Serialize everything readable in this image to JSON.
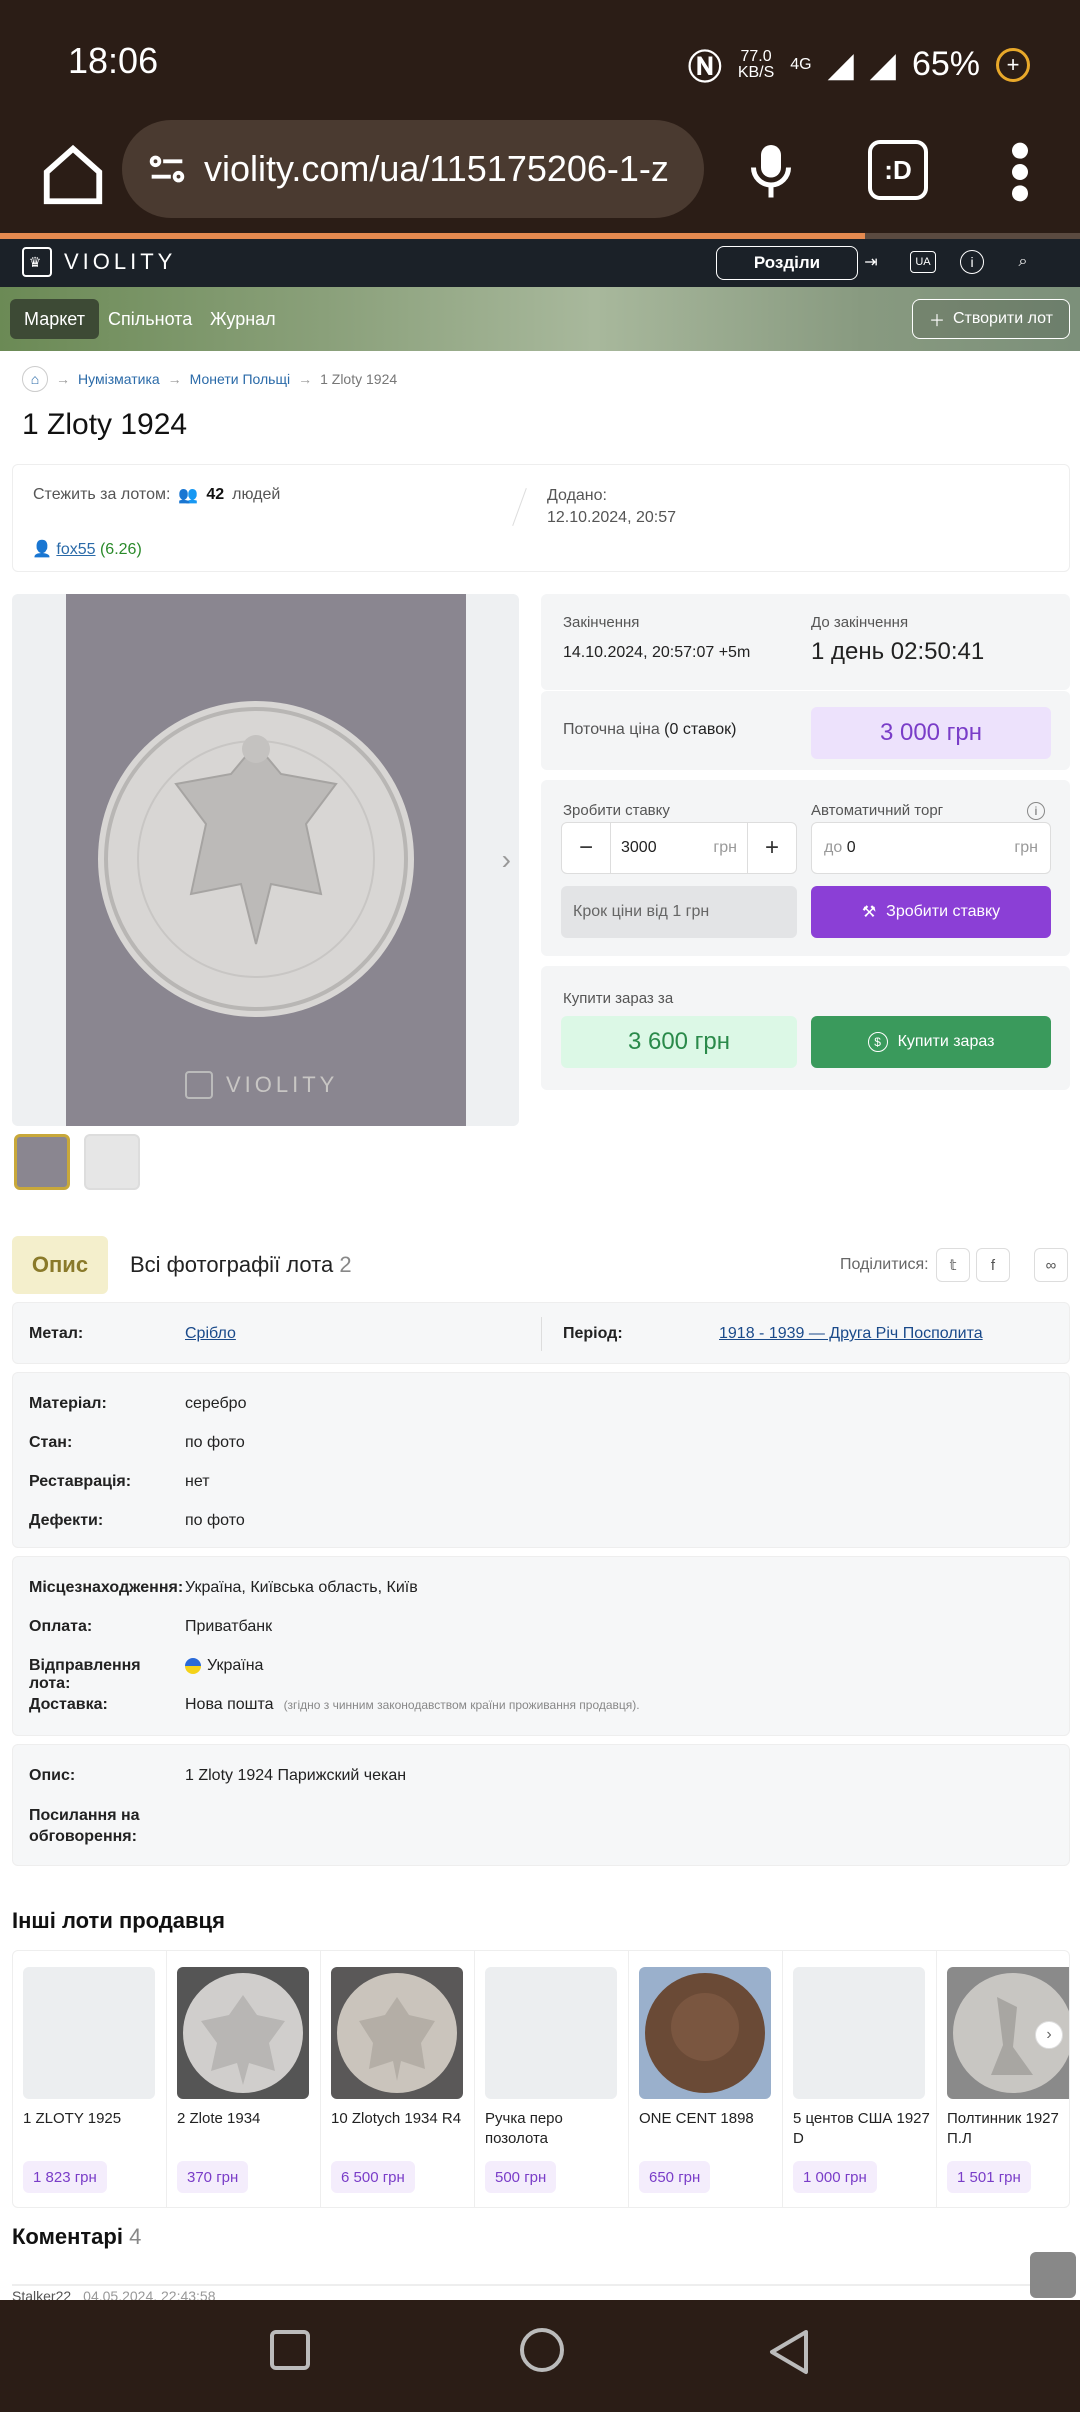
{
  "status": {
    "time": "18:06",
    "speed": "77.0",
    "speed_unit": "KB/S",
    "network": "4G",
    "battery": "65%"
  },
  "browser": {
    "url": "violity.com/ua/115175206-1-z",
    "ext_label": ":D"
  },
  "site": {
    "logo": "VIOLITY",
    "sections_label": "Розділи",
    "lang": "UA",
    "tabs": [
      "Маркет",
      "Спільнота",
      "Журнал"
    ],
    "create_label": "Створити лот"
  },
  "breadcrumb": [
    "Нумізматика",
    "Монети Польщі",
    "1 Zloty 1924"
  ],
  "lot": {
    "title": "1 Zloty 1924",
    "watch_label": "Стежить за лотом:",
    "watch_count": "42",
    "watch_unit": "людей",
    "added_label": "Додано:",
    "added_value": "12.10.2024, 20:57",
    "seller": "fox55",
    "seller_rating": "(6.26)"
  },
  "auction": {
    "end_label": "Закінчення",
    "end_value": "14.10.2024, 20:57:07 +5m",
    "left_label": "До закінчення",
    "left_value": "1 день 02:50:41",
    "current_label": "Поточна ціна",
    "bids": "(0 ставок)",
    "current_price": "3 000 грн",
    "bid_label": "Зробити ставку",
    "auto_label": "Автоматичний торг",
    "bid_value": "3000",
    "currency": "грн",
    "auto_prefix": "до",
    "auto_value": "0",
    "step_placeholder": "Крок ціни від 1 грн",
    "bid_button": "Зробити ставку",
    "buy_label": "Купити зараз за",
    "buy_price": "3 600 грн",
    "buy_button": "Купити зараз"
  },
  "description": {
    "tab_desc": "Опис",
    "tab_photos": "Всі фотографії лота",
    "photos_count": "2",
    "share_label": "Поділитися:",
    "metal_label": "Метал:",
    "metal_value": "Срібло",
    "period_label": "Період:",
    "period_value": "1918 - 1939 — Друга Річ Посполита",
    "material_label": "Матеріал:",
    "material_value": "серебро",
    "condition_label": "Стан:",
    "condition_value": "по фото",
    "restoration_label": "Реставрація:",
    "restoration_value": "нет",
    "defects_label": "Дефекти:",
    "defects_value": "по фото",
    "location_label": "Місцезнаходження:",
    "location_value": "Україна, Київська область, Київ",
    "payment_label": "Оплата:",
    "payment_value": "Приватбанк",
    "shipping_from_label": "Відправлення лота:",
    "shipping_from_value": "Україна",
    "delivery_label": "Доставка:",
    "delivery_value": "Нова пошта",
    "delivery_note": "(згідно з чинним законодавством країни проживання продавця).",
    "desc_label": "Опис:",
    "desc_value": "1 Zloty 1924 Парижский чекан",
    "links_label_1": "Посилання на",
    "links_label_2": "обговорення:"
  },
  "other_lots_title": "Інші лоти продавця",
  "other_lots": [
    {
      "name": "1 ZLOTY 1925",
      "price": "1 823 грн"
    },
    {
      "name": "2 Zlote 1934",
      "price": "370 грн"
    },
    {
      "name": "10 Zlotych 1934 R4",
      "price": "6 500 грн"
    },
    {
      "name": "Ручка перо позолота",
      "price": "500 грн"
    },
    {
      "name": "ONE CENT 1898",
      "price": "650 грн"
    },
    {
      "name": "5 центов США 1927 D",
      "price": "1 000 грн"
    },
    {
      "name": "Полтинник 1927 П.Л",
      "price": "1 501 грн"
    }
  ],
  "comments": {
    "title": "Коментарі",
    "count": "4",
    "first_user": "Stalker22",
    "first_date": "04.05.2024, 22:43:58"
  },
  "colors": {
    "accent_purple": "#8b3fd6",
    "buy_green": "#3a9a5c",
    "header_dark": "#1b2128",
    "system_brown": "#2b1d16"
  }
}
